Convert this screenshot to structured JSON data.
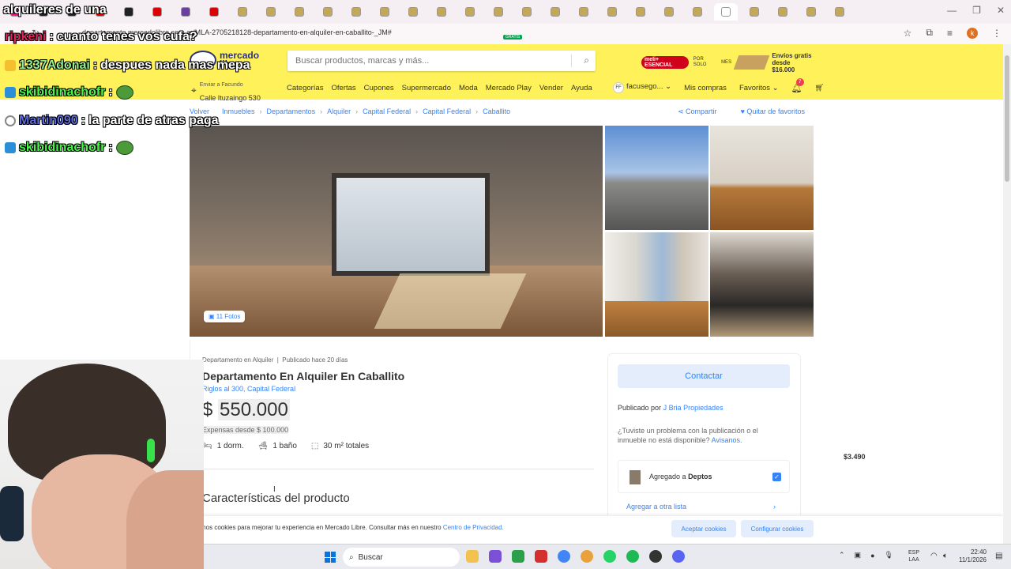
{
  "browser": {
    "url": "departamento.mercadolibre.com.ar/MLA-2705218128-departamento-en-alquiler-en-caballito-_JM#",
    "tab_count": 35
  },
  "header": {
    "logo_line1": "mercado",
    "logo_line2": "libre",
    "search_placeholder": "Buscar productos, marcas y más...",
    "promo": {
      "meli_badge": "meli+ ESENCIAL",
      "price_prefix": "POR SOLO",
      "price": "$3.490",
      "price_suffix": "MES",
      "shipping_line1": "Envíos gratis",
      "shipping_line2": "desde $16.000"
    },
    "location_line1": "Enviar a Facundo",
    "location_line2": "Calle Ituzaingo 530",
    "nav": [
      "Categorías",
      "Ofertas",
      "Cupones",
      "Supermercado",
      "Moda",
      "Mercado Play",
      "Vender",
      "Ayuda"
    ],
    "nav_new_badge": "GRATIS",
    "user_initials": "FF",
    "user_name": "facusego...",
    "my_purchases": "Mis compras",
    "favorites": "Favoritos",
    "notif_count": "7"
  },
  "breadcrumb": {
    "back": "Volver",
    "items": [
      "Inmuebles",
      "Departamentos",
      "Alquiler",
      "Capital Federal",
      "Capital Federal",
      "Caballito"
    ],
    "share": "Compartir",
    "unfavorite": "Quitar de favoritos"
  },
  "gallery": {
    "photos_badge": "11 Fotos"
  },
  "listing": {
    "meta_type": "Departamento en Alquiler",
    "meta_published": "Publicado hace 20 días",
    "title": "Departamento En Alquiler En Caballito",
    "address": "Riglos al 300, Capital Federal",
    "currency": "$",
    "price": "550.000",
    "expensas": "Expensas desde $ 100.000",
    "bedrooms": "1 dorm.",
    "bathrooms": "1 baño",
    "area": "30 m² totales",
    "section_title": "Características del producto"
  },
  "sidebar": {
    "contact_button": "Contactar",
    "published_by_label": "Publicado por",
    "publisher": "J Bria Propiedades",
    "problem_text": "¿Tuviste un problema con la publicación o el inmueble no está disponible?",
    "problem_link": "Avisanos.",
    "added_prefix": "Agregado a",
    "added_list": "Deptos",
    "other_list": "Agregar a otra lista"
  },
  "cookies": {
    "text": "mos cookies para mejorar tu experiencia en Mercado Libre. Consultar más en nuestro",
    "link": "Centro de Privacidad.",
    "accept": "Aceptar cookies",
    "configure": "Configurar cookies"
  },
  "chat": [
    {
      "user": "alquileres de una",
      "msg": "",
      "color": "#ffffff"
    },
    {
      "user": "ripkeni",
      "msg": "cuanto tenes vos cufa?",
      "color": "#e0245e"
    },
    {
      "user": "1337Adonai",
      "msg": "despues nada mas mepa",
      "color": "#90ee90"
    },
    {
      "user": "skibidinachofr",
      "msg": ":",
      "color": "#4bf54b"
    },
    {
      "user": "Martin090",
      "msg": "la parte de atras paga",
      "color": "#5b6ad8"
    },
    {
      "user": "skibidinachofr",
      "msg": ":",
      "color": "#4bf54b"
    }
  ],
  "taskbar": {
    "search": "Buscar",
    "lang_line1": "ESP",
    "lang_line2": "LAA",
    "time": "22:40",
    "date": "11/1/2026"
  }
}
